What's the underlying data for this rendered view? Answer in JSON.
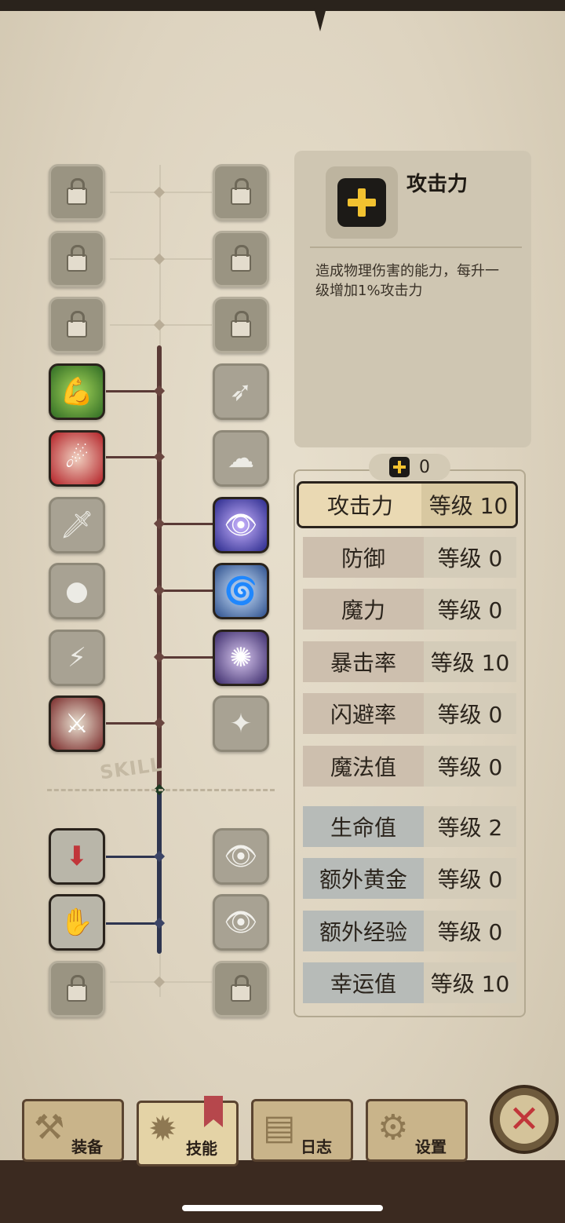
{
  "info": {
    "title": "攻击力",
    "description": "造成物理伤害的能力，每升一级增加1%攻击力"
  },
  "points": {
    "value": "0"
  },
  "tree": {
    "watermark": "SKILL"
  },
  "stats": [
    {
      "name": "攻击力",
      "level": "等级 10",
      "group": "red",
      "selected": true
    },
    {
      "name": "防御",
      "level": "等级 0",
      "group": "red"
    },
    {
      "name": "魔力",
      "level": "等级 0",
      "group": "red"
    },
    {
      "name": "暴击率",
      "level": "等级 10",
      "group": "red"
    },
    {
      "name": "闪避率",
      "level": "等级 0",
      "group": "red"
    },
    {
      "name": "魔法值",
      "level": "等级 0",
      "group": "red"
    },
    {
      "name": "生命值",
      "level": "等级 2",
      "group": "blue"
    },
    {
      "name": "额外黄金",
      "level": "等级 0",
      "group": "blue"
    },
    {
      "name": "额外经验",
      "level": "等级 0",
      "group": "blue"
    },
    {
      "name": "幸运值",
      "level": "等级 10",
      "group": "blue"
    }
  ],
  "tabs": [
    {
      "label": "装备",
      "icon": "axe-icon"
    },
    {
      "label": "技能",
      "icon": "skill-icon"
    },
    {
      "label": "日志",
      "icon": "journal-icon"
    },
    {
      "label": "设置",
      "icon": "gear-icon"
    }
  ],
  "close": {
    "glyph": "✕"
  },
  "colors": {
    "accent_yellow": "#f2c230",
    "tree_red": "#5a3a36",
    "tree_blue": "#2e3550",
    "close_red": "#c1363a"
  }
}
